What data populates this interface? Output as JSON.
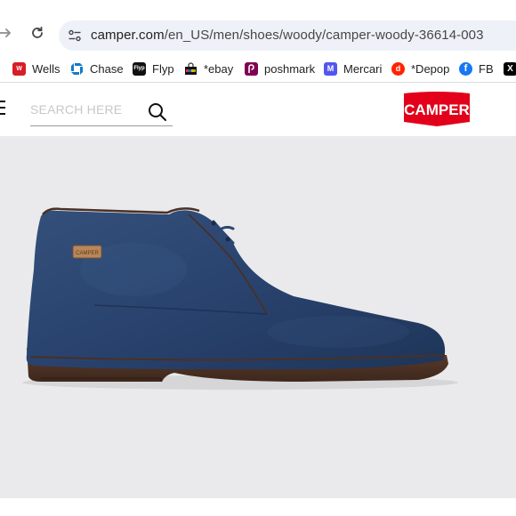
{
  "browser": {
    "url_host": "camper.com",
    "url_path": "/en_US/men/shoes/woody/camper-woody-36614-003",
    "bookmarks": [
      {
        "label": "Wells",
        "icon": "wells-fargo-icon",
        "color": "#d71e28"
      },
      {
        "label": "Chase",
        "icon": "chase-icon",
        "color": "#117aca"
      },
      {
        "label": "Flyp",
        "icon": "flyp-icon",
        "color": "#111111"
      },
      {
        "label": "*ebay",
        "icon": "ebay-bag-icon",
        "color": "#e53238"
      },
      {
        "label": "poshmark",
        "icon": "poshmark-icon",
        "color": "#7f0353"
      },
      {
        "label": "Mercari",
        "icon": "mercari-icon",
        "color": "#5356ee"
      },
      {
        "label": "*Depop",
        "icon": "depop-icon",
        "color": "#ff2300"
      },
      {
        "label": "FB",
        "icon": "facebook-icon",
        "color": "#1877f2"
      }
    ]
  },
  "header": {
    "search_placeholder": "SEARCH HERE",
    "logo_text": "CAMPER",
    "logo_color": "#e2001a"
  },
  "product": {
    "image": "navy suede chukka boot",
    "tag_text": "CAMPER"
  }
}
